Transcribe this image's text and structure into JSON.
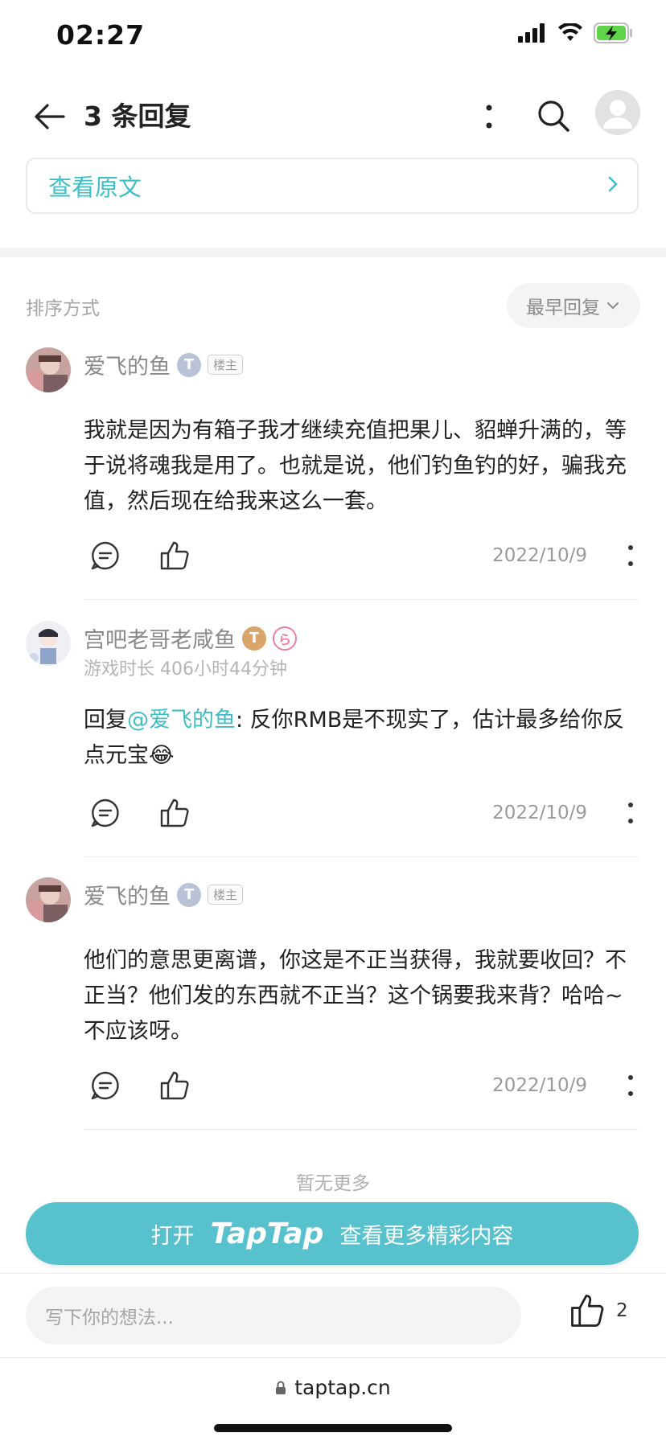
{
  "status_bar": {
    "time": "02:27"
  },
  "app_bar": {
    "title": "3 条回复"
  },
  "view_original": {
    "label": "查看原文"
  },
  "sort": {
    "label": "排序方式",
    "selected": "最早回复"
  },
  "comments": [
    {
      "name": "爱飞的鱼",
      "level_badge": "T",
      "owner_badge": "楼主",
      "subtitle": "",
      "text": "我就是因为有箱子我才继续充值把果儿、貂蝉升满的，等于说将魂我是用了。也就是说，他们钓鱼钓的好，骗我充值，然后现在给我来这么一套。",
      "date": "2022/10/9"
    },
    {
      "name": "宫吧老哥老咸鱼",
      "level_badge": "T",
      "extra_badge": "ら",
      "subtitle": "游戏时长 406小时44分钟",
      "reply_prefix": "回复",
      "mention": "@爱飞的鱼",
      "text": ": 反你RMB是不现实了，估计最多给你反点元宝😂",
      "date": "2022/10/9"
    },
    {
      "name": "爱飞的鱼",
      "level_badge": "T",
      "owner_badge": "楼主",
      "subtitle": "",
      "text": "他们的意思更离谱，你这是不正当获得，我就要收回？不正当？他们发的东西就不正当？这个锅要我来背？哈哈~不应该呀。",
      "date": "2022/10/9"
    }
  ],
  "no_more": "暂无更多",
  "open_app": {
    "prefix": "打开",
    "brand": "TapTap",
    "suffix": "查看更多精彩内容"
  },
  "bottom": {
    "input_placeholder": "写下你的想法...",
    "like_count": "2"
  },
  "browser": {
    "url": "taptap.cn"
  },
  "colors": {
    "accent": "#3ebfc6",
    "button": "#57c2cd"
  }
}
